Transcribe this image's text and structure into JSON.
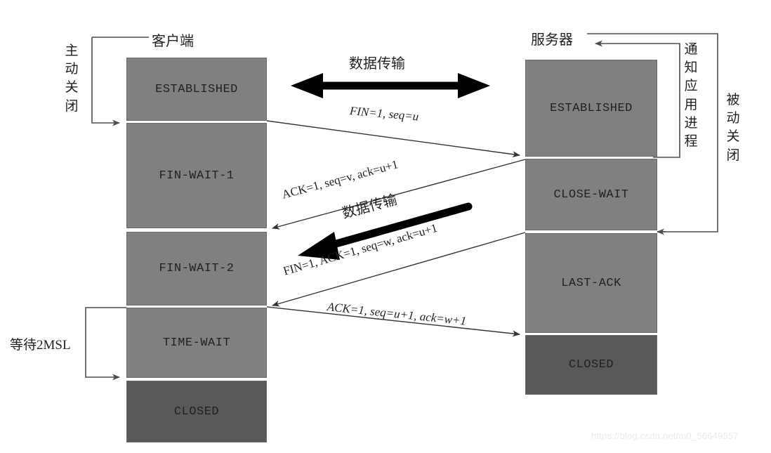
{
  "diagram": {
    "title_client": "客户端",
    "title_server": "服务器",
    "watermark": "https://blog.csdn.net/m0_56649557",
    "colors": {
      "state_fill": "#808080",
      "closed_fill": "#595959",
      "state_border": "#6a6a6a",
      "line": "#4d4d4d",
      "arrow_bold": "#000000",
      "text": "#231f20",
      "background": "#ffffff",
      "watermark": "#eaeaea"
    },
    "annotations": {
      "active_close": "主动关闭",
      "passive_close": "被动关闭",
      "notify_app_process": "通知应用进程",
      "wait_2msl": "等待2MSL"
    },
    "data_transfer_label_top": "数据传输",
    "data_transfer_label_bottom": "数据传输"
  },
  "client": {
    "name": "客户端",
    "states": [
      {
        "label": "ESTABLISHED",
        "kind": "open"
      },
      {
        "label": "FIN-WAIT-1",
        "kind": "open"
      },
      {
        "label": "FIN-WAIT-2",
        "kind": "open"
      },
      {
        "label": "TIME-WAIT",
        "kind": "open"
      },
      {
        "label": "CLOSED",
        "kind": "closed"
      }
    ]
  },
  "server": {
    "name": "服务器",
    "states": [
      {
        "label": "ESTABLISHED",
        "kind": "open"
      },
      {
        "label": "CLOSE-WAIT",
        "kind": "open"
      },
      {
        "label": "LAST-ACK",
        "kind": "open"
      },
      {
        "label": "CLOSED",
        "kind": "closed"
      }
    ]
  },
  "messages": [
    {
      "id": "fin1",
      "text": "FIN=1,  seq=u",
      "direction": "client-to-server"
    },
    {
      "id": "ack1",
      "text": "ACK=1, seq=v, ack=u+1",
      "direction": "server-to-client"
    },
    {
      "id": "finack",
      "text": "FIN=1,  ACK=1,  seq=w, ack=u+1",
      "direction": "server-to-client"
    },
    {
      "id": "ack2",
      "text": "ACK=1, seq=u+1, ack=w+1",
      "direction": "client-to-server"
    }
  ]
}
